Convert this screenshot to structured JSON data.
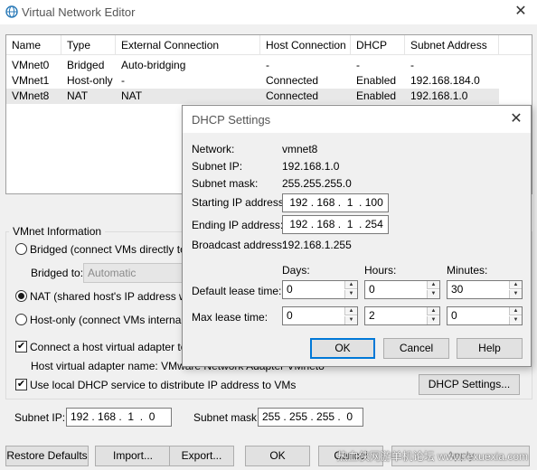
{
  "window": {
    "title": "Virtual Network Editor",
    "close_glyph": "✕"
  },
  "table": {
    "columns": [
      "Name",
      "Type",
      "External Connection",
      "Host Connection",
      "DHCP",
      "Subnet Address"
    ],
    "rows": [
      [
        "VMnet0",
        "Bridged",
        "Auto-bridging",
        "-",
        "-",
        "-"
      ],
      [
        "VMnet1",
        "Host-only",
        "-",
        "Connected",
        "Enabled",
        "192.168.184.0"
      ],
      [
        "VMnet8",
        "NAT",
        "NAT",
        "Connected",
        "Enabled",
        "192.168.1.0"
      ]
    ],
    "selected_row": 2
  },
  "vmnet_info": {
    "label": "VMnet Information",
    "bridged_label": "Bridged (connect VMs directly to the",
    "bridged_to_label": "Bridged to:",
    "bridged_to_value": "Automatic",
    "nat_label": "NAT (shared host's IP address with",
    "hostonly_label": "Host-only (connect VMs internally in",
    "connect_adapter_label": "Connect a host virtual adapter to th",
    "adapter_name_label": "Host virtual adapter name: VMware Network Adapter VMnet8",
    "use_dhcp_label": "Use local DHCP service to distribute IP address to VMs",
    "dhcp_settings_button": "DHCP Settings...",
    "subnet_ip_label": "Subnet IP:",
    "subnet_ip_value": "192 . 168 .  1  .  0",
    "subnet_mask_label": "Subnet mask:",
    "subnet_mask_value": "255 . 255 . 255 .  0"
  },
  "bottom_buttons": {
    "restore": "Restore Defaults",
    "import": "Import...",
    "export": "Export...",
    "ok": "OK",
    "cancel": "Cancel",
    "apply": "Apply"
  },
  "dhcp_dialog": {
    "title": "DHCP Settings",
    "network_label": "Network:",
    "network_value": "vmnet8",
    "subnet_ip_label": "Subnet IP:",
    "subnet_ip_value": "192.168.1.0",
    "subnet_mask_label": "Subnet mask:",
    "subnet_mask_value": "255.255.255.0",
    "start_ip_label": "Starting IP address:",
    "start_ip_value": " 192 . 168 .  1  . 100",
    "end_ip_label": "Ending IP address:",
    "end_ip_value": " 192 . 168 .  1  . 254",
    "broadcast_label": "Broadcast address:",
    "broadcast_value": "192.168.1.255",
    "days_label": "Days:",
    "hours_label": "Hours:",
    "minutes_label": "Minutes:",
    "default_lease_label": "Default lease time:",
    "default_days": "0",
    "default_hours": "0",
    "default_minutes": "30",
    "max_lease_label": "Max lease time:",
    "max_days": "0",
    "max_hours": "2",
    "max_minutes": "0",
    "ok": "OK",
    "cancel": "Cancel",
    "help": "Help"
  },
  "watermark": "热血侠网游单机论坛 www.rexuexia.com",
  "colors": {
    "focus_blue": "#0078d7",
    "selection": "#e8e8e8"
  }
}
